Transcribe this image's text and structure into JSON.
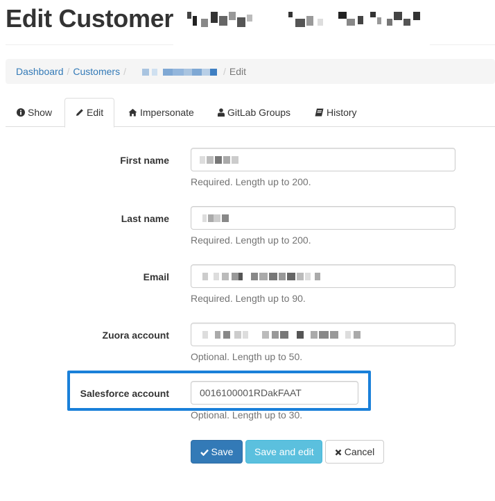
{
  "header": {
    "title": "Edit Customer"
  },
  "breadcrumb": {
    "dashboard": "Dashboard",
    "customers": "Customers",
    "separator": "/",
    "current": "Edit"
  },
  "tabs": [
    {
      "label": "Show",
      "icon": "info-circle-icon",
      "active": false
    },
    {
      "label": "Edit",
      "icon": "pencil-icon",
      "active": true
    },
    {
      "label": "Impersonate",
      "icon": "home-icon",
      "active": false
    },
    {
      "label": "GitLab Groups",
      "icon": "user-icon",
      "active": false
    },
    {
      "label": "History",
      "icon": "book-icon",
      "active": false
    }
  ],
  "form": {
    "first_name": {
      "label": "First name",
      "help": "Required. Length up to 200."
    },
    "last_name": {
      "label": "Last name",
      "help": "Required. Length up to 200."
    },
    "email": {
      "label": "Email",
      "help": "Required. Length up to 90."
    },
    "zuora_account": {
      "label": "Zuora account",
      "help": "Optional. Length up to 50."
    },
    "salesforce_account": {
      "label": "Salesforce account",
      "value": "0016100001RDakFAAT",
      "help": "Optional. Length up to 30."
    }
  },
  "actions": {
    "save": "Save",
    "save_and_edit": "Save and edit",
    "cancel": "Cancel"
  },
  "colors": {
    "primary": "#337ab7",
    "info": "#5bc0de",
    "highlight": "#1a80d9",
    "link": "#337ab7"
  }
}
